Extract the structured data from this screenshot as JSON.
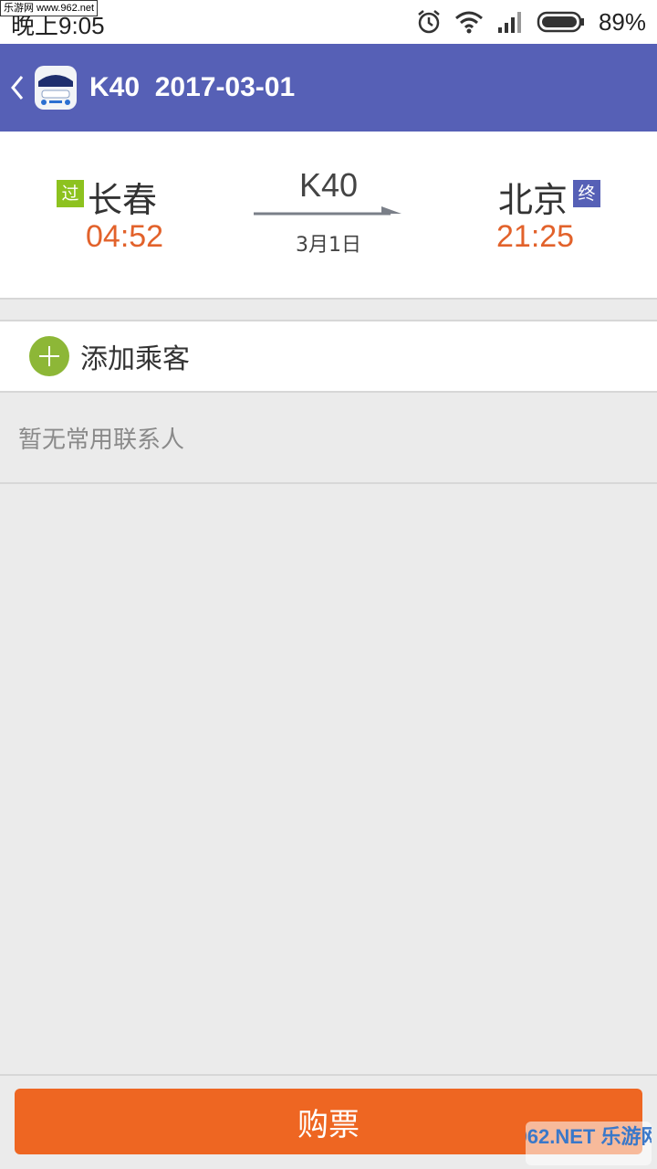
{
  "status_bar": {
    "watermark": "乐游网 www.962.net",
    "time": "晚上9:05",
    "battery": "89%",
    "icons": [
      "alarm-icon",
      "wifi-icon",
      "signal-icon",
      "battery-icon"
    ]
  },
  "app_bar": {
    "title": "K40  2017-03-01",
    "back_icon": "chevron-left-icon",
    "logo": "train-logo-icon",
    "background": "#5660b6"
  },
  "trip": {
    "from_badge": "过",
    "from_station": "长春",
    "from_time": "04:52",
    "train_number": "K40",
    "date": "3月1日",
    "to_badge": "终",
    "to_station": "北京",
    "to_time": "21:25",
    "from_badge_color": "#8dc21f",
    "to_badge_color": "#5660b6",
    "time_color": "#e2622b"
  },
  "passenger": {
    "add_label": "添加乘客",
    "empty_text": "暂无常用联系人"
  },
  "footer": {
    "buy_label": "购票",
    "button_color": "#ee6622",
    "watermark": "962.NET 乐游网"
  }
}
